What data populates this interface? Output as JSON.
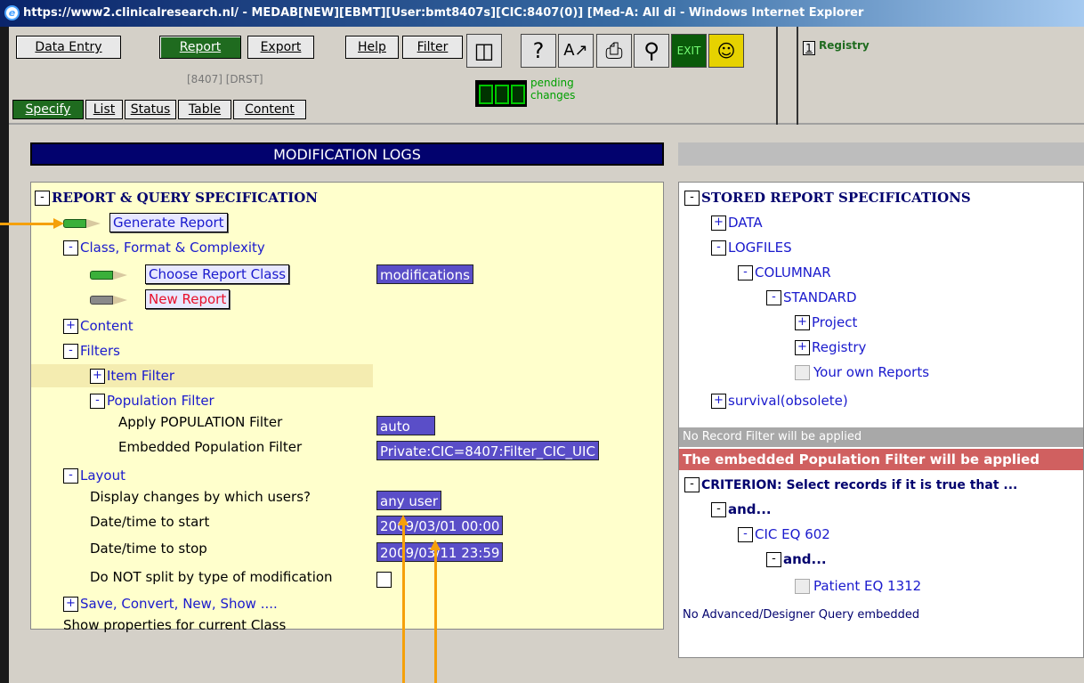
{
  "window": {
    "title": "https://www2.clinicalresearch.nl/ - MEDAB[NEW][EBMT][User:bmt8407s][CIC:8407(0)] [Med-A: All di - Windows Internet Explorer"
  },
  "toolbar": {
    "buttons": [
      "Data Entry",
      "Report",
      "Export",
      "Help",
      "Filter"
    ],
    "sysinfo": "[8407] [DRST]",
    "view_tabs": [
      "Specify",
      "List",
      "Status",
      "Table",
      "Content"
    ],
    "pending_label_1": "pending",
    "pending_label_2": "changes",
    "registry_number": "1",
    "registry_label": "Registry",
    "icons": [
      "copy-records-icon",
      "help-query-icon",
      "font-size-icon",
      "print-icon",
      "search-icon",
      "exit-icon",
      "smiley-navigation-icon"
    ]
  },
  "left": {
    "header": "MODIFICATION LOGS",
    "spec_title": "REPORT & QUERY SPECIFICATION",
    "generate_report": "Generate Report",
    "class_format": "Class, Format & Complexity",
    "choose_report_class": "Choose Report Class",
    "report_class_value": "modifications",
    "new_report": "New Report",
    "content": "Content",
    "filters": "Filters",
    "item_filter": "Item Filter",
    "population_filter": "Population Filter",
    "apply_population_label": "Apply POPULATION Filter",
    "apply_population_value": "auto",
    "embedded_population_label": "Embedded Population Filter",
    "embedded_population_value": "Private:CIC=8407:Filter_CIC_UIC",
    "layout": "Layout",
    "display_changes_label": "Display changes by which users?",
    "display_changes_value": "any user",
    "start_label": "Date/time to start",
    "start_value": "2009/03/01 00:00",
    "stop_label": "Date/time to stop",
    "stop_value": "2009/03/11 23:59",
    "no_split_label": "Do NOT split by type of modification",
    "save_convert": "Save, Convert, New, Show ....",
    "show_properties": "Show properties for current Class"
  },
  "right": {
    "stored_title": "STORED REPORT SPECIFICATIONS",
    "tree": {
      "data": "DATA",
      "logfiles": "LOGFILES",
      "columnar": "COLUMNAR",
      "standard": "STANDARD",
      "project": "Project",
      "registry": "Registry",
      "own_reports": "Your own Reports",
      "survival": "survival(obsolete)"
    },
    "no_record_filter": "No Record Filter will be applied",
    "embedded_applied": "The embedded Population Filter will be applied",
    "criterion": "CRITERION: Select records if it is true that ...",
    "and1": "and...",
    "cic": "CIC EQ 602",
    "and2": "and...",
    "patient": "Patient EQ 1312",
    "no_advanced": "No Advanced/Designer Query embedded"
  },
  "plus": "+",
  "minus": "-",
  "colors": {
    "annotation_arrow": "#f5a00a",
    "header_navy": "#02026e",
    "value_purple": "#5a4ec8",
    "active_green": "#1f6b1f"
  }
}
